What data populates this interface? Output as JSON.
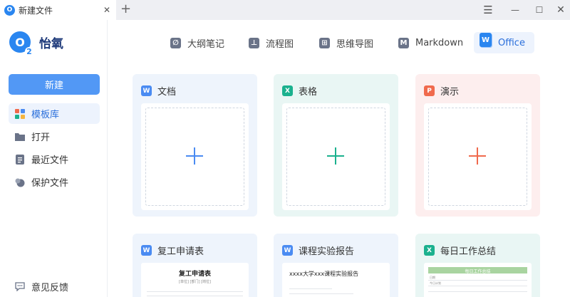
{
  "window": {
    "tab_title": "新建文件",
    "tab_logo": "O",
    "close_glyph": "✕",
    "newtab_glyph": "+",
    "menu_glyph": "☰",
    "min_glyph": "—",
    "max_glyph": "☐",
    "winclose_glyph": "✕"
  },
  "brand": {
    "name": "怡氧",
    "logo_letter": "O",
    "logo_sub": "2"
  },
  "sidebar": {
    "new_button": "新建",
    "items": [
      {
        "label": "模板库",
        "icon": "template-icon",
        "active": true
      },
      {
        "label": "打开",
        "icon": "folder-icon",
        "active": false
      },
      {
        "label": "最近文件",
        "icon": "recent-file-icon",
        "active": false
      },
      {
        "label": "保护文件",
        "icon": "protect-icon",
        "active": false
      }
    ],
    "feedback": "意见反馈"
  },
  "type_tabs": [
    {
      "label": "大纲笔记",
      "icon": "outline-note-icon",
      "glyph": "∅"
    },
    {
      "label": "流程图",
      "icon": "flowchart-icon",
      "glyph": "⊥"
    },
    {
      "label": "思维导图",
      "icon": "mindmap-icon",
      "glyph": "⊞"
    },
    {
      "label": "Markdown",
      "icon": "markdown-icon",
      "glyph": "M"
    },
    {
      "label": "Office",
      "icon": "office-icon",
      "glyph": "W",
      "active": true
    }
  ],
  "new_cards": [
    {
      "label": "文档",
      "badge": "W",
      "color": "#4a8bf2"
    },
    {
      "label": "表格",
      "badge": "X",
      "color": "#1bb18e"
    },
    {
      "label": "演示",
      "badge": "P",
      "color": "#f06a4d"
    }
  ],
  "template_cards": [
    {
      "label": "复工申请表",
      "badge": "W",
      "preview_title": "复工申请表",
      "preview_sub": "[单位]    [部门]    [岗位]"
    },
    {
      "label": "课程实验报告",
      "badge": "W",
      "preview_title": "xxxx大学xxx课程实验报告"
    },
    {
      "label": "每日工作总结",
      "badge": "X",
      "preview_title": "每日工作总结",
      "preview_row1": "日期",
      "preview_row2": "今日计划"
    }
  ]
}
